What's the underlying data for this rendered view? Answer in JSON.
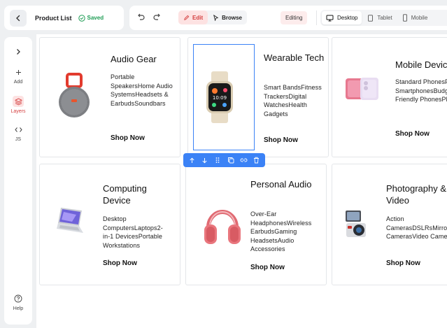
{
  "header": {
    "title": "Product List",
    "saved_label": "Saved"
  },
  "toolbar": {
    "edit_label": "Edit",
    "browse_label": "Browse",
    "editing_label": "Editing",
    "devices": [
      "Desktop",
      "Tablet",
      "Mobile"
    ],
    "active_device": "Desktop"
  },
  "rail": {
    "add_label": "Add",
    "layers_label": "Layers",
    "js_label": "JS",
    "help_label": "Help"
  },
  "cards": [
    {
      "title": "Audio Gear",
      "desc": "Portable SpeakersHome Audio SystemsHeadsets & EarbudsSoundbars",
      "link": "Shop Now",
      "image": "jbl-speaker"
    },
    {
      "title": "Wearable Tech",
      "desc": "Smart BandsFitness TrackersDigital WatchesHealth Gadgets",
      "link": "Shop Now",
      "image": "smartwatch"
    },
    {
      "title": "Mobile Devices",
      "desc": "Standard PhonesPremium SmartphonesBudget Friendly PhonesPhablets",
      "link": "Shop Now",
      "image": "smartphone"
    },
    {
      "title": "Computing Device",
      "desc": "Desktop ComputersLaptops2-in-1 DevicesPortable Workstations",
      "link": "Shop Now",
      "image": "laptop"
    },
    {
      "title": "Personal Audio",
      "desc": "Over-Ear HeadphonesWireless EarbudsGaming HeadsetsAudio Accessories",
      "link": "Shop Now",
      "image": "headphones"
    },
    {
      "title": "Photography & Video",
      "desc": "Action CamerasDSLRsMirrorless CamerasVideo Cameras",
      "link": "Shop Now",
      "image": "camera"
    }
  ],
  "colors": {
    "accent": "#d43f3f",
    "selection": "#3b82f6",
    "saved": "#1f9d55"
  }
}
